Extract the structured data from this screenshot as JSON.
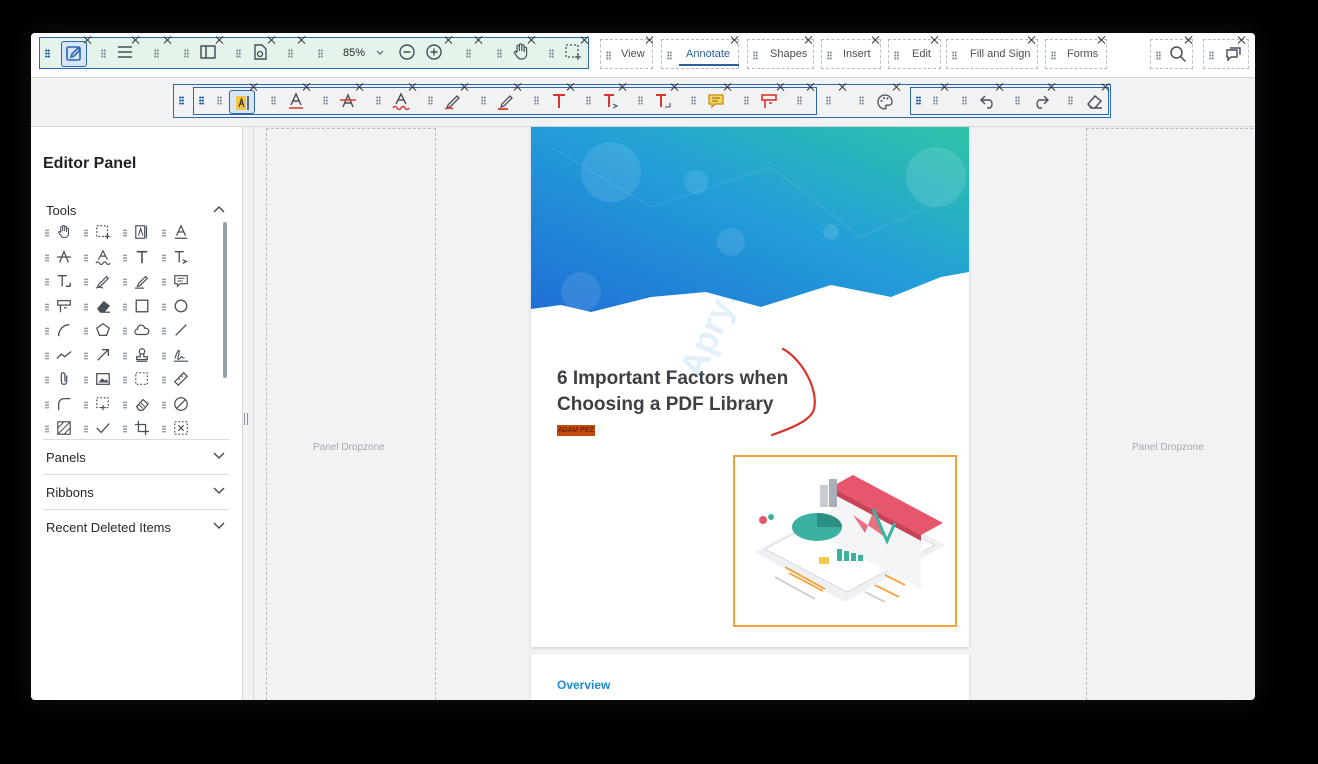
{
  "colors": {
    "accent": "#2c67b0",
    "highlight_fill": "#e4f4ea",
    "annotate_underline": "#2b5f9d",
    "orange_frame": "#f2a134",
    "pen_red": "#d9342b"
  },
  "toolbar": {
    "zoom_value": "85%",
    "left_group_icons": [
      "edit-icon",
      "menu-icon",
      "sidebar-icon",
      "file-search-icon",
      "zoom-out-icon",
      "zoom-in-icon",
      "pan-icon",
      "marquee-zoom-icon"
    ],
    "tabs": [
      {
        "label": "View",
        "selected": false
      },
      {
        "label": "Annotate",
        "selected": true
      },
      {
        "label": "Shapes",
        "selected": false
      },
      {
        "label": "Insert",
        "selected": false
      },
      {
        "label": "Edit",
        "selected": false
      },
      {
        "label": "Fill and Sign",
        "selected": false
      },
      {
        "label": "Forms",
        "selected": false
      }
    ],
    "right_icons": [
      "search-icon",
      "comments-panel-icon"
    ]
  },
  "ribbon": {
    "tools": [
      "text-highlight-icon",
      "text-underline-icon",
      "text-strikeout-icon",
      "text-squiggly-icon",
      "free-hand-icon",
      "free-hand-highlight-icon",
      "free-text-icon",
      "callout-text-icon",
      "add-text-icon",
      "sticky-note-icon",
      "text-box-icon",
      "color-palette-icon",
      "undo-icon",
      "redo-icon",
      "eraser-icon"
    ]
  },
  "left_panel": {
    "title": "Editor Panel",
    "sections": [
      {
        "label": "Tools",
        "expanded": true
      },
      {
        "label": "Panels",
        "expanded": false
      },
      {
        "label": "Ribbons",
        "expanded": false
      },
      {
        "label": "Recent Deleted Items",
        "expanded": false
      }
    ]
  },
  "dropzones": {
    "left_label": "Panel Dropzone",
    "right_label": "Panel Dropzone"
  },
  "document": {
    "headline_line1": "6 Important Factors when",
    "headline_line2": "Choosing a PDF Library",
    "author_tag": "ADAM PEZ",
    "section_heading": "Overview",
    "watermark": "Apryse"
  }
}
